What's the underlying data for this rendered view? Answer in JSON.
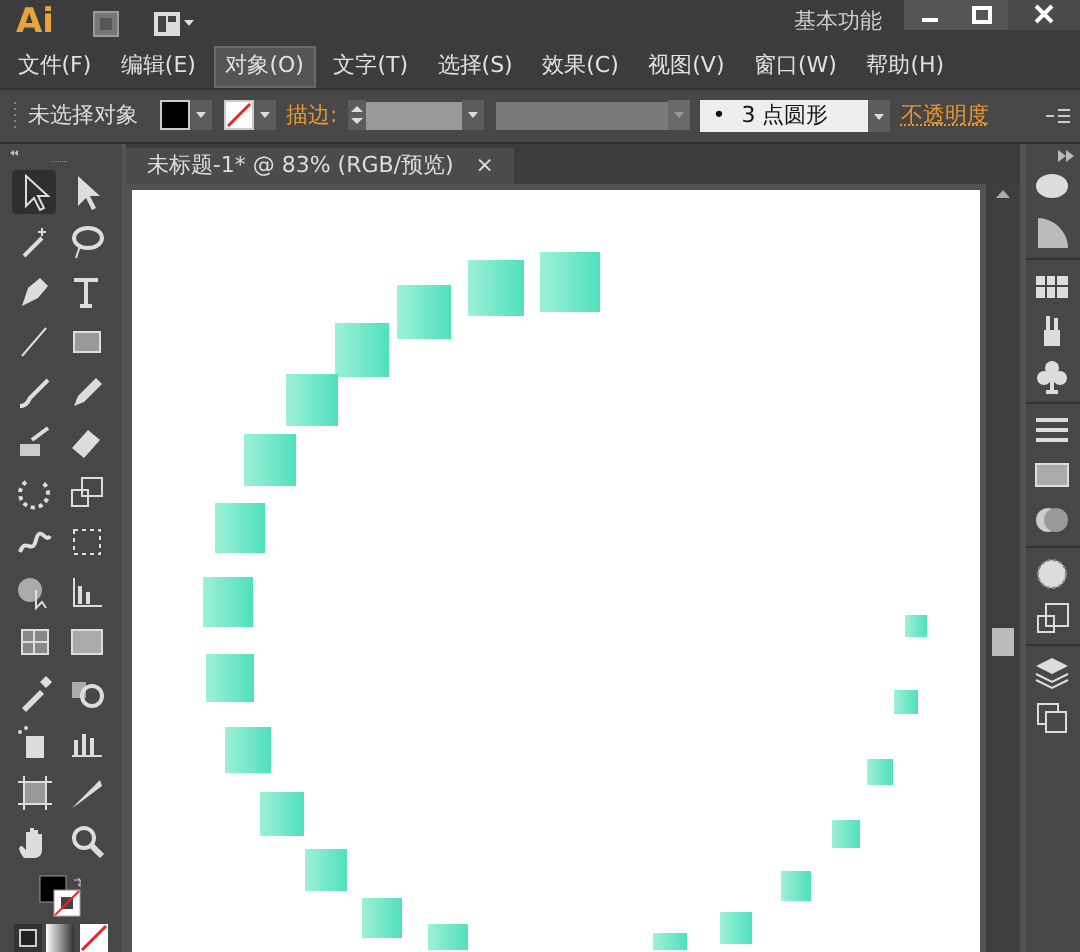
{
  "app": {
    "logo": "Ai",
    "workspace": "基本功能"
  },
  "menu": [
    {
      "label": "文件(F)",
      "selected": false
    },
    {
      "label": "编辑(E)",
      "selected": false
    },
    {
      "label": "对象(O)",
      "selected": true
    },
    {
      "label": "文字(T)",
      "selected": false
    },
    {
      "label": "选择(S)",
      "selected": false
    },
    {
      "label": "效果(C)",
      "selected": false
    },
    {
      "label": "视图(V)",
      "selected": false
    },
    {
      "label": "窗口(W)",
      "selected": false
    },
    {
      "label": "帮助(H)",
      "selected": false
    }
  ],
  "control_bar": {
    "selection": "未选择对象",
    "stroke_label": "描边:",
    "brush_dot": "•",
    "brush": "3 点圆形",
    "opacity_label": "不透明度"
  },
  "document_tab": {
    "title": "未标题-1* @ 83% (RGB/预览)",
    "close": "×"
  }
}
